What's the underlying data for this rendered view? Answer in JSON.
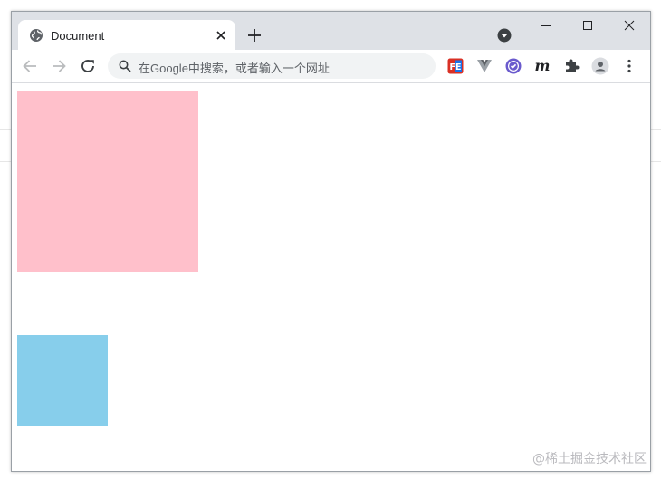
{
  "browser": {
    "tab": {
      "title": "Document"
    },
    "omnibox": {
      "placeholder": "在Google中搜索，或者输入一个网址"
    }
  },
  "extensions": [
    "fe-helper-icon",
    "vue-devtools-icon",
    "checkmark-badge-icon",
    "m-extension-icon",
    "puzzle-icon",
    "profile-avatar-icon",
    "more-menu-icon"
  ],
  "page": {
    "boxes": [
      {
        "name": "pink-box",
        "color": "#ffc0cb"
      },
      {
        "name": "blue-box",
        "color": "#87ceeb"
      }
    ]
  },
  "watermark": "@稀土掘金技术社区"
}
